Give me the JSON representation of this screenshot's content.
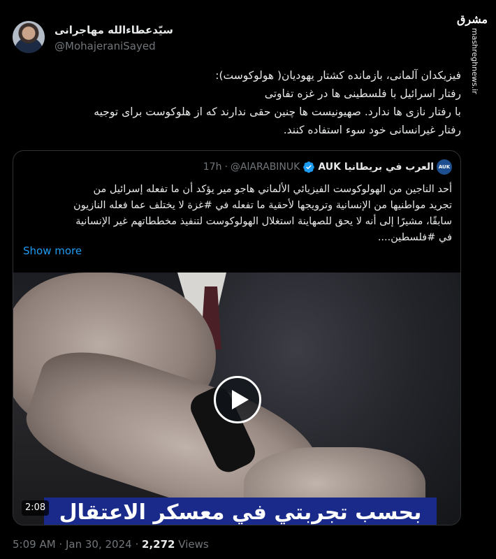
{
  "author": {
    "name": "سیّدعطاءالله مهاجرانی",
    "handle": "@MohajeraniSayed"
  },
  "brand": {
    "logo": "مشرق",
    "url": "mashreghnews.ir"
  },
  "tweet": {
    "lines": [
      "فیزیکدان آلمانی، بازمانده کشتار یهودیان( هولوکوست):",
      "رفتار اسرائیل با فلسطینی ها در غزه تفاوتی",
      "با  رفتار نازی ها ندارد. صهیونیست ها چنین حقی ندارند که از هلوکوست برای توجیه",
      "رفتار غیرانسانی خود سوء استفاده کنند."
    ]
  },
  "quote": {
    "avatar_label": "AUK",
    "name": "العرب في بريطانيا AUK",
    "handle": "@AlARABINUK",
    "separator": "·",
    "time": "17h",
    "lines": [
      "أحد الناجين من الهولوكوست الفيزيائي الألماني هاجو مير يؤكد أن ما تفعله إسرائيل من",
      "تجريد مواطنيها من الإنسانية وترويجها لأحقية ما تفعله في #غزة لا يختلف عما فعله النازيون",
      "سابقًا، مشيرًا إلى أنه لا يحق للصهاينة استغلال الهولوكوست لتنفيذ مخططاتهم غير الإنسانية",
      "في #فلسطين...."
    ],
    "show_more": "Show more",
    "video": {
      "duration": "2:08",
      "caption": "بحسب تجربتي في معسكر الاعتقال"
    }
  },
  "meta": {
    "time": "5:09 AM",
    "dot1": "·",
    "date": "Jan 30, 2024",
    "dot2": "·",
    "views_count": "2,272",
    "views_label": "Views"
  },
  "colors": {
    "background": "#000000",
    "link": "#1d9bf0",
    "muted": "#71767b",
    "verified": "#1d9bf0"
  }
}
